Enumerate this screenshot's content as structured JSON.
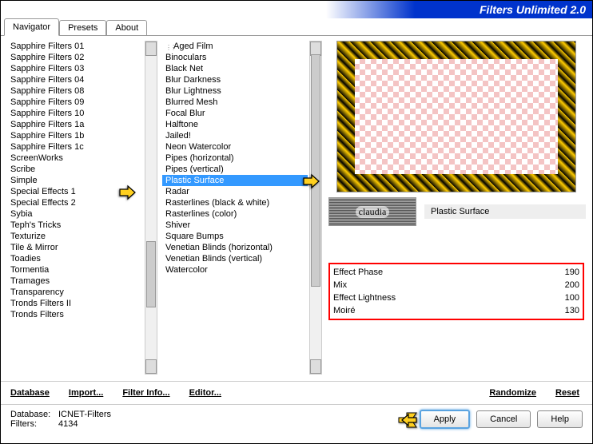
{
  "title": "Filters Unlimited 2.0",
  "tabs": [
    "Navigator",
    "Presets",
    "About"
  ],
  "active_tab": 0,
  "categories": [
    "Sapphire Filters 01",
    "Sapphire Filters 02",
    "Sapphire Filters 03",
    "Sapphire Filters 04",
    "Sapphire Filters 08",
    "Sapphire Filters 09",
    "Sapphire Filters 10",
    "Sapphire Filters 1a",
    "Sapphire Filters 1b",
    "Sapphire Filters 1c",
    "ScreenWorks",
    "Scribe",
    "Simple",
    "Special Effects 1",
    "Special Effects 2",
    "Sybia",
    "Teph's Tricks",
    "Texturize",
    "Tile & Mirror",
    "Toadies",
    "Tormentia",
    "Tramages",
    "Transparency",
    "Tronds Filters II",
    "Tronds Filters"
  ],
  "selected_category_index": 13,
  "filters": [
    "Aged Film",
    "Binoculars",
    "Black Net",
    "Blur Darkness",
    "Blur Lightness",
    "Blurred Mesh",
    "Focal Blur",
    "Halftone",
    "Jailed!",
    "Neon Watercolor",
    "Pipes (horizontal)",
    "Pipes (vertical)",
    "Plastic Surface",
    "Radar",
    "Rasterlines (black & white)",
    "Rasterlines (color)",
    "Shiver",
    "Square Bumps",
    "Venetian Blinds (horizontal)",
    "Venetian Blinds (vertical)",
    "Watercolor"
  ],
  "selected_filter_index": 12,
  "watermark_text": "claudia",
  "current_filter_name": "Plastic Surface",
  "params": [
    {
      "label": "Effect Phase",
      "value": 190
    },
    {
      "label": "Mix",
      "value": 200
    },
    {
      "label": "Effect Lightness",
      "value": 100
    },
    {
      "label": "Moiré",
      "value": 130
    }
  ],
  "toolbar": {
    "database": "Database",
    "import": "Import...",
    "filter_info": "Filter Info...",
    "editor": "Editor...",
    "randomize": "Randomize",
    "reset": "Reset"
  },
  "status": {
    "db_label": "Database:",
    "db_value": "ICNET-Filters",
    "filters_label": "Filters:",
    "filters_value": "4134"
  },
  "buttons": {
    "apply": "Apply",
    "cancel": "Cancel",
    "help": "Help"
  }
}
